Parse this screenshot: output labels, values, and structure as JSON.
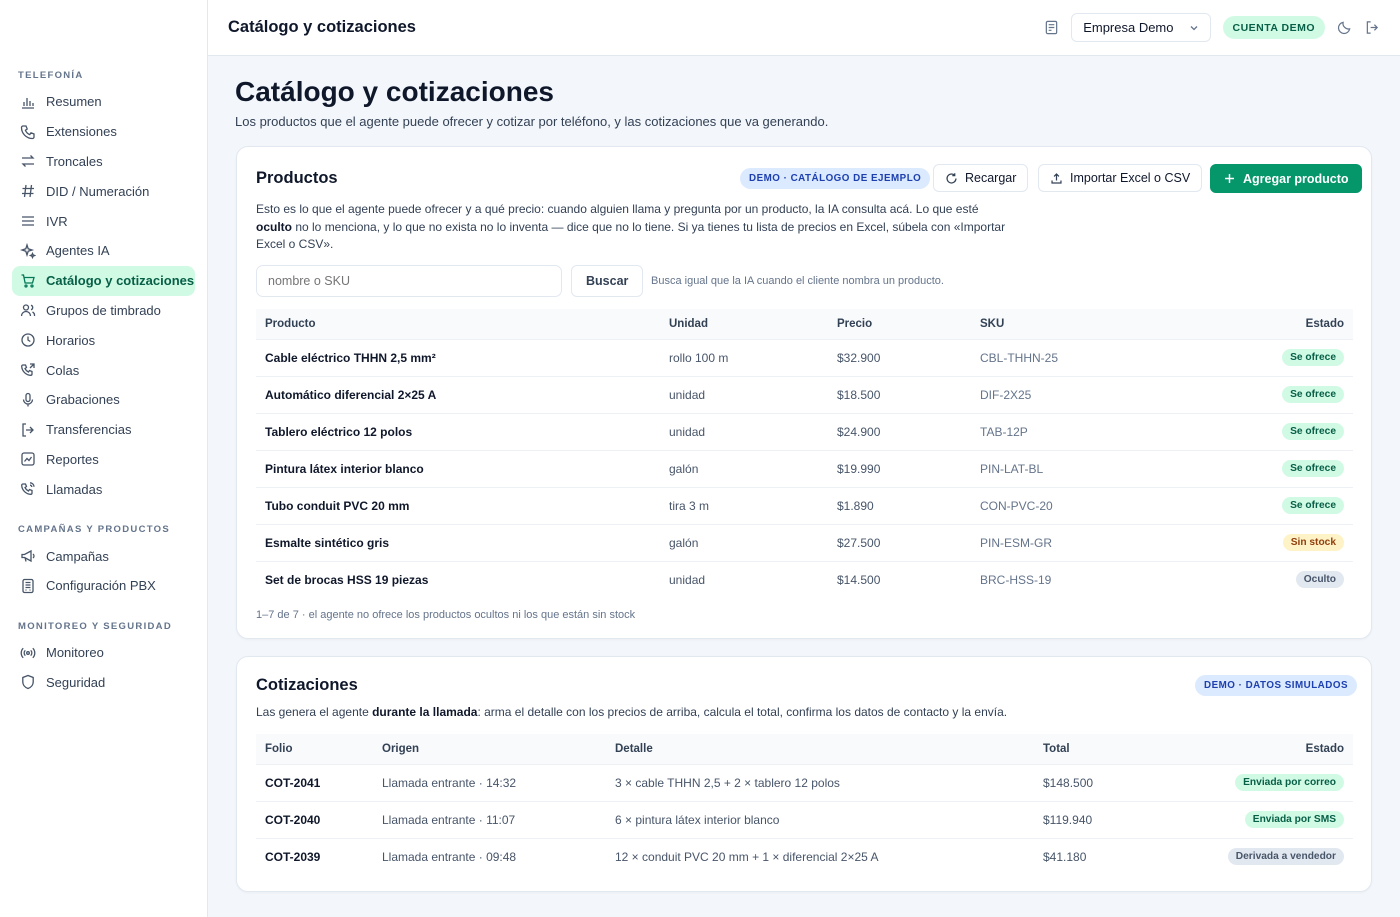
{
  "sidebar": {
    "sections": [
      {
        "title": "TELEFONÍA",
        "items": [
          "Resumen",
          "Extensiones",
          "Troncales",
          "DID / Numeración",
          "IVR",
          "Agentes IA",
          "Catálogo y cotizaciones",
          "Grupos de timbrado",
          "Horarios",
          "Colas",
          "Grabaciones",
          "Transferencias",
          "Reportes",
          "Llamadas"
        ]
      },
      {
        "title": "CAMPAÑAS Y PRODUCTOS",
        "items": [
          "Campañas",
          "Configuración PBX"
        ]
      },
      {
        "title": "MONITOREO Y SEGURIDAD",
        "items": [
          "Monitoreo",
          "Seguridad"
        ]
      }
    ]
  },
  "topbar": {
    "title": "Catálogo y cotizaciones",
    "company": "Empresa Demo",
    "badge": "CUENTA DEMO"
  },
  "page": {
    "title": "Catálogo y cotizaciones",
    "subtitle": "Los productos que el agente puede ofrecer y cotizar por teléfono, y las cotizaciones que va generando."
  },
  "productos": {
    "title": "Productos",
    "demo_badge": "DEMO · CATÁLOGO DE EJEMPLO",
    "btn_reload": "Recargar",
    "btn_import": "Importar Excel o CSV",
    "btn_add": "Agregar producto",
    "desc_1": "Esto es lo que el agente puede ofrecer y a qué precio: cuando alguien llama y pregunta por un producto, la IA consulta acá. Lo que esté",
    "desc_bold": "oculto",
    "desc_2": " no lo menciona, y lo que no exista no lo inventa — dice que no lo tiene. Si ya tienes tu lista de precios en Excel, súbela con «Importar",
    "desc_3": "Excel o CSV».",
    "search_placeholder": "nombre o SKU",
    "search_button": "Buscar",
    "search_hint": "Busca igual que la IA cuando el cliente nombra un producto.",
    "columns": [
      "Producto",
      "Unidad",
      "Precio",
      "SKU",
      "Estado"
    ],
    "rows": [
      {
        "name": "Cable eléctrico THHN 2,5 mm²",
        "unit": "rollo 100 m",
        "price": "$32.900",
        "sku": "CBL-THHN-25",
        "status": "Se ofrece",
        "kind": "green"
      },
      {
        "name": "Automático diferencial 2×25 A",
        "unit": "unidad",
        "price": "$18.500",
        "sku": "DIF-2X25",
        "status": "Se ofrece",
        "kind": "green"
      },
      {
        "name": "Tablero eléctrico 12 polos",
        "unit": "unidad",
        "price": "$24.900",
        "sku": "TAB-12P",
        "status": "Se ofrece",
        "kind": "green"
      },
      {
        "name": "Pintura látex interior blanco",
        "unit": "galón",
        "price": "$19.990",
        "sku": "PIN-LAT-BL",
        "status": "Se ofrece",
        "kind": "green"
      },
      {
        "name": "Tubo conduit PVC 20 mm",
        "unit": "tira 3 m",
        "price": "$1.890",
        "sku": "CON-PVC-20",
        "status": "Se ofrece",
        "kind": "green"
      },
      {
        "name": "Esmalte sintético gris",
        "unit": "galón",
        "price": "$27.500",
        "sku": "PIN-ESM-GR",
        "status": "Sin stock",
        "kind": "amber"
      },
      {
        "name": "Set de brocas HSS 19 piezas",
        "unit": "unidad",
        "price": "$14.500",
        "sku": "BRC-HSS-19",
        "status": "Oculto",
        "kind": "gray"
      }
    ],
    "footer": "1–7 de 7 · el agente no ofrece los productos ocultos ni los que están sin stock"
  },
  "cotizaciones": {
    "title": "Cotizaciones",
    "demo_badge": "DEMO · DATOS SIMULADOS",
    "desc_1": "Las genera el agente ",
    "desc_bold": "durante la llamada",
    "desc_2": ": arma el detalle con los precios de arriba, calcula el total, confirma los datos de contacto y la envía.",
    "columns": [
      "Folio",
      "Origen",
      "Detalle",
      "Total",
      "Estado"
    ],
    "rows": [
      {
        "folio": "COT-2041",
        "origin": "Llamada entrante · 14:32",
        "detail": "3 × cable THHN 2,5 + 2 × tablero 12 polos",
        "total": "$148.500",
        "status": "Enviada por correo",
        "kind": "green"
      },
      {
        "folio": "COT-2040",
        "origin": "Llamada entrante · 11:07",
        "detail": "6 × pintura látex interior blanco",
        "total": "$119.940",
        "status": "Enviada por SMS",
        "kind": "green"
      },
      {
        "folio": "COT-2039",
        "origin": "Llamada entrante · 09:48",
        "detail": "12 × conduit PVC 20 mm + 1 × diferencial 2×25 A",
        "total": "$41.180",
        "status": "Derivada a vendedor",
        "kind": "gray"
      }
    ]
  },
  "colors": {
    "accent": "#059669",
    "accent_soft": "#d1fae5",
    "demo_badge_bg": "#dbeafe",
    "demo_badge_fg": "#1e40af"
  }
}
